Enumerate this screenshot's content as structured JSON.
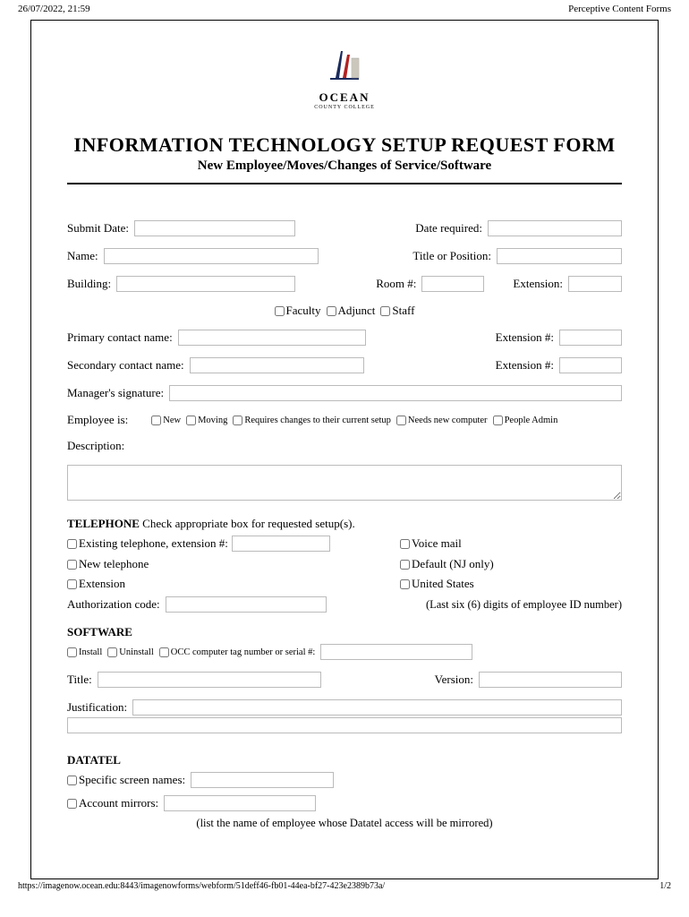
{
  "header": {
    "datetime": "26/07/2022, 21:59",
    "page_label": "Perceptive Content Forms"
  },
  "logo": {
    "name": "OCEAN",
    "subtitle": "COUNTY COLLEGE"
  },
  "title": "INFORMATION TECHNOLOGY SETUP REQUEST FORM",
  "subtitle": "New Employee/Moves/Changes of Service/Software",
  "labels": {
    "submit_date": "Submit Date:",
    "date_required": "Date required:",
    "name": "Name:",
    "title_position": "Title or Position:",
    "building": "Building:",
    "room": "Room #:",
    "extension": "Extension:",
    "faculty": "Faculty",
    "adjunct": "Adjunct",
    "staff": "Staff",
    "primary_contact": "Primary contact name:",
    "extension_num": "Extension #:",
    "secondary_contact": "Secondary contact name:",
    "manager_sig": "Manager's signature:",
    "employee_is": "Employee is:",
    "emp_new": "New",
    "emp_moving": "Moving",
    "emp_changes": "Requires changes to their current setup",
    "emp_newcomp": "Needs new computer",
    "emp_peopleadmin": "People Admin",
    "description": "Description:"
  },
  "telephone": {
    "heading": "TELEPHONE",
    "sub": "Check appropriate box for requested setup(s).",
    "existing": "Existing telephone, extension #:",
    "voicemail": "Voice mail",
    "new_tel": "New telephone",
    "default_nj": "Default (NJ only)",
    "ext": "Extension",
    "us": "United States",
    "auth_code": "Authorization code:",
    "auth_hint": "(Last six (6) digits of employee ID number)"
  },
  "software": {
    "heading": "SOFTWARE",
    "install": "Install",
    "uninstall": "Uninstall",
    "tag": "OCC computer tag number or serial #:",
    "title": "Title:",
    "version": "Version:",
    "justification": "Justification:"
  },
  "datatel": {
    "heading": "DATATEL",
    "screen_names": "Specific screen names:",
    "account_mirrors": "Account mirrors:",
    "hint": "(list the name of employee whose Datatel access will be mirrored)"
  },
  "footer": {
    "url": "https://imagenow.ocean.edu:8443/imagenowforms/webform/51deff46-fb01-44ea-bf27-423e2389b73a/",
    "page": "1/2"
  }
}
